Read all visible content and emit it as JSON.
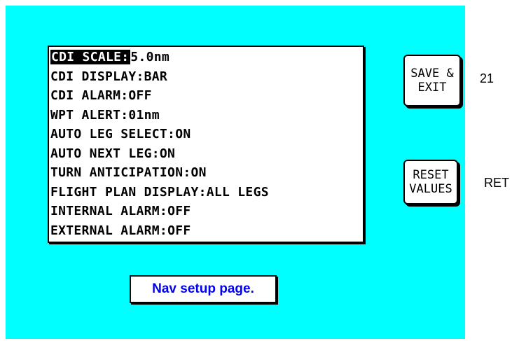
{
  "settings": [
    {
      "label": "CDI SCALE:",
      "value": "5.0nm",
      "selected": true
    },
    {
      "label": "CDI DISPLAY:",
      "value": "BAR"
    },
    {
      "label": "CDI ALARM:",
      "value": "OFF"
    },
    {
      "label": "WPT ALERT:",
      "value": "01nm"
    },
    {
      "label": "AUTO LEG SELECT:",
      "value": "ON"
    },
    {
      "label": "AUTO NEXT LEG:",
      "value": "ON"
    },
    {
      "label": "TURN ANTICIPATION:",
      "value": "ON"
    },
    {
      "label": "FLIGHT PLAN DISPLAY:",
      "value": "ALL LEGS"
    },
    {
      "label": "INTERNAL ALARM:",
      "value": "OFF"
    },
    {
      "label": "EXTERNAL ALARM:",
      "value": "OFF"
    }
  ],
  "buttons": {
    "save_exit": {
      "line1": "SAVE &",
      "line2": "EXIT",
      "key": "21"
    },
    "reset_values": {
      "line1": "RESET",
      "line2": "VALUES",
      "key": "RET"
    }
  },
  "caption": "Nav setup page.",
  "colors": {
    "screen_background": "#00ffff",
    "caption_text": "#0000ee",
    "selected_highlight": "#000000"
  }
}
